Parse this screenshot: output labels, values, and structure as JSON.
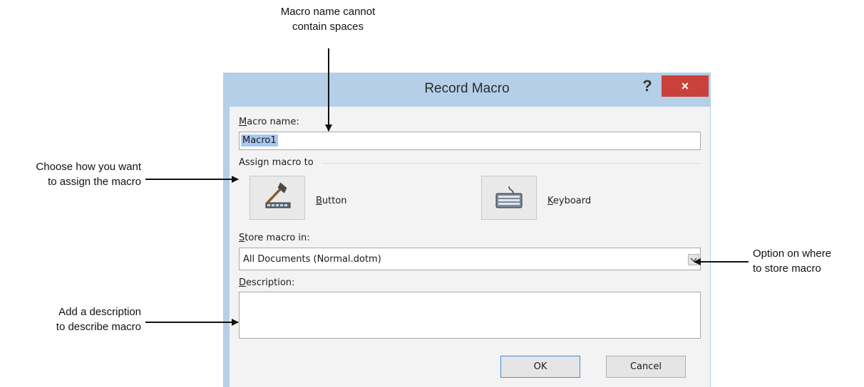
{
  "callouts": {
    "top": [
      "Macro name cannot",
      "contain spaces"
    ],
    "assign": [
      "Choose how you want",
      "to assign the macro"
    ],
    "description": [
      "Add a description",
      "to describe macro"
    ],
    "store": [
      "Option on where",
      "to store macro"
    ]
  },
  "dialog": {
    "title": "Record Macro",
    "help_label": "?",
    "close_label": "×",
    "macro_name_label_key": "M",
    "macro_name_label_rest": "acro name:",
    "macro_name_value": "Macro1",
    "assign_label": "Assign macro to",
    "button_label_key": "B",
    "button_label_rest": "utton",
    "keyboard_label_key": "K",
    "keyboard_label_rest": "eyboard",
    "store_label_key": "S",
    "store_label_rest": "tore macro in:",
    "store_value": "All Documents (Normal.dotm)",
    "description_label_key": "D",
    "description_label_rest": "escription:",
    "description_value": "",
    "ok_label": "OK",
    "cancel_label": "Cancel"
  },
  "colors": {
    "frame": "#b5cfe8",
    "close": "#c9413b",
    "selection": "#a8c8ee"
  },
  "icons": {
    "button_icon": "hammer-toolbar-icon",
    "keyboard_icon": "keyboard-icon",
    "store_arrow": "chevron-down-icon"
  }
}
